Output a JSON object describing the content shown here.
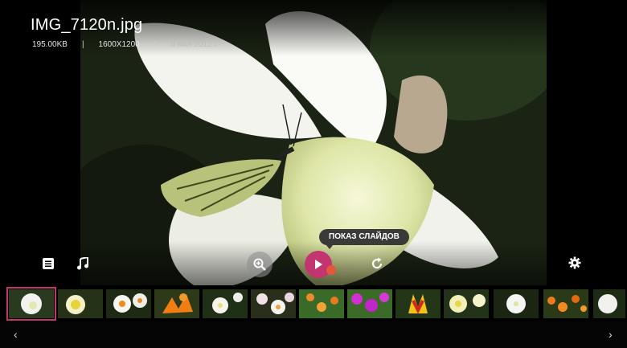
{
  "file": {
    "name": "IMG_7120n.jpg",
    "size": "195.00KB",
    "resolution": "1600X1200",
    "date": "8 мая 2012 г."
  },
  "meta_separator": "|",
  "controls": {
    "list_icon": "list-icon",
    "music_icon": "music-note-icon",
    "zoom_icon": "zoom-in-icon",
    "play_icon": "play-icon",
    "rotate_icon": "rotate-icon",
    "settings_icon": "gear-icon",
    "slideshow_tooltip": "ПОКАЗ СЛАЙДОВ"
  },
  "colors": {
    "accent": "#c2356f",
    "tooltip_bg": "#3a3a3a"
  },
  "thumbnails": [
    {
      "name": "white-daffodil",
      "selected": true
    },
    {
      "name": "yellow-daffodil",
      "selected": false
    },
    {
      "name": "white-orange-daffodil",
      "selected": false
    },
    {
      "name": "orange-lily",
      "selected": false
    },
    {
      "name": "white-narcissus",
      "selected": false
    },
    {
      "name": "pink-white-flowers",
      "selected": false
    },
    {
      "name": "orange-green-flowers",
      "selected": false
    },
    {
      "name": "magenta-flowers",
      "selected": false
    },
    {
      "name": "red-yellow-tulip",
      "selected": false
    },
    {
      "name": "cream-daffodils",
      "selected": false
    },
    {
      "name": "white-narcissus-2",
      "selected": false
    },
    {
      "name": "orange-tulips",
      "selected": false
    },
    {
      "name": "white-flower",
      "selected": false
    }
  ],
  "nav": {
    "prev": "‹",
    "next": "›"
  }
}
